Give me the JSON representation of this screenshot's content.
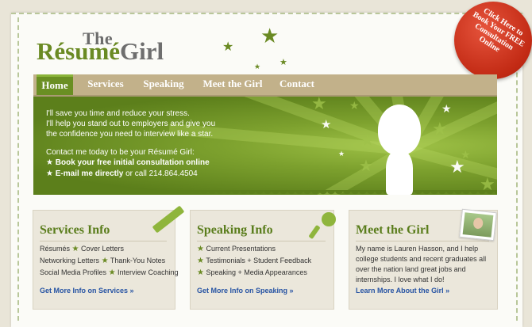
{
  "logo": {
    "the": "The",
    "resume": "Résumé",
    "girl": "Girl"
  },
  "sticker": {
    "text": "Click Here to Book Your FREE Consultation Online"
  },
  "nav": {
    "items": [
      {
        "label": "Home"
      },
      {
        "label": "Services"
      },
      {
        "label": "Speaking"
      },
      {
        "label": "Meet the Girl"
      },
      {
        "label": "Contact"
      }
    ]
  },
  "hero": {
    "line1": "I'll save you time and reduce your stress.",
    "line2": "I'll help you stand out to employers and give you",
    "line3": "the confidence you need to interview like a star.",
    "contact_intro": "Contact me today to be your Résumé Girl:",
    "book_link": "Book your free initial consultation online",
    "email_link": "E-mail me directly",
    "call_text": " or call 214.864.4504"
  },
  "services": {
    "title": "Services Info",
    "items": [
      "Résumés",
      "Cover Letters",
      "Networking Letters",
      "Thank-You Notes",
      "Social Media Profiles",
      "Interview Coaching"
    ],
    "link": "Get More Info on Services »"
  },
  "speaking": {
    "title": "Speaking Info",
    "items": [
      "Current Presentations",
      "Testimonials + Student Feedback",
      "Speaking + Media Appearances"
    ],
    "link": "Get More Info on Speaking »"
  },
  "girl": {
    "title": "Meet the Girl",
    "lines": [
      "My name is Lauren Hasson, and I help",
      "college students and recent graduates all",
      "over the nation land great jobs and",
      "internships. I love what I do!"
    ],
    "link": "Learn More About the Girl »"
  },
  "colors": {
    "brand_green": "#6a8a23",
    "nav_tan": "#c2b18a",
    "link_blue": "#2653a3",
    "sticker_red": "#c22a14"
  }
}
